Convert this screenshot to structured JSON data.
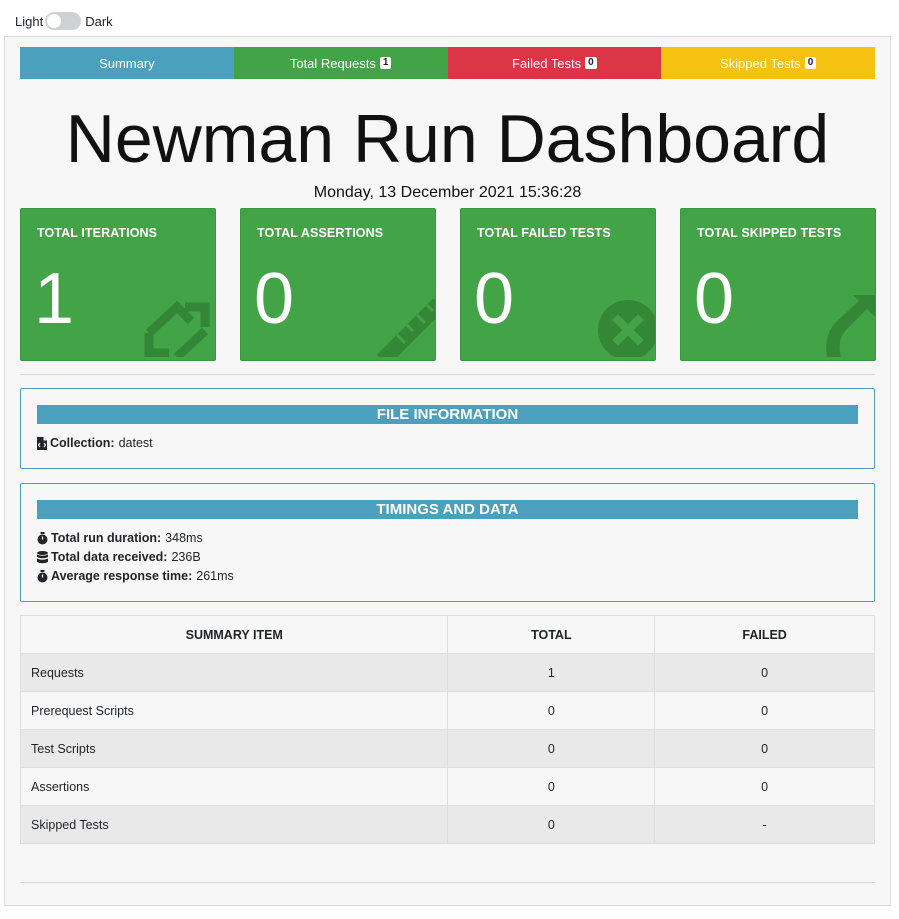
{
  "theme_toggle": {
    "light_label": "Light",
    "dark_label": "Dark",
    "state": "light"
  },
  "tabs": [
    {
      "label": "Summary",
      "badge": null,
      "color": "#4ba1bd"
    },
    {
      "label": "Total Requests",
      "badge": "1",
      "color": "#43a447"
    },
    {
      "label": "Failed Tests",
      "badge": "0",
      "color": "#dc3545"
    },
    {
      "label": "Skipped Tests",
      "badge": "0",
      "color": "#f5c211"
    }
  ],
  "title": "Newman Run Dashboard",
  "run_date": "Monday, 13 December 2021 15:36:28",
  "cards": [
    {
      "label": "TOTAL ITERATIONS",
      "value": "1",
      "icon": "sync-icon"
    },
    {
      "label": "TOTAL ASSERTIONS",
      "value": "0",
      "icon": "ruler-icon"
    },
    {
      "label": "TOTAL FAILED TESTS",
      "value": "0",
      "icon": "times-circle-icon"
    },
    {
      "label": "TOTAL SKIPPED TESTS",
      "value": "0",
      "icon": "share-arrow-icon"
    }
  ],
  "file_info": {
    "header": "FILE INFORMATION",
    "collection_label": "Collection:",
    "collection_value": "datest"
  },
  "timings": {
    "header": "TIMINGS AND DATA",
    "duration_label": "Total run duration:",
    "duration_value": "348ms",
    "data_label": "Total data received:",
    "data_value": "236B",
    "avg_label": "Average response time:",
    "avg_value": "261ms"
  },
  "summary_table": {
    "headers": [
      "SUMMARY ITEM",
      "TOTAL",
      "FAILED"
    ],
    "rows": [
      [
        "Requests",
        "1",
        "0"
      ],
      [
        "Prerequest Scripts",
        "0",
        "0"
      ],
      [
        "Test Scripts",
        "0",
        "0"
      ],
      [
        "Assertions",
        "0",
        "0"
      ],
      [
        "Skipped Tests",
        "0",
        "-"
      ]
    ]
  },
  "colors": {
    "primary": "#4ba1bd",
    "success": "#43a447",
    "danger": "#dc3545",
    "warning": "#f5c211"
  }
}
